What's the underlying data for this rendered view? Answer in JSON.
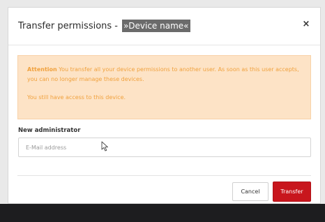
{
  "dialog": {
    "title_prefix": "Transfer permissions - ",
    "title_device": "»Device name«",
    "close_icon": "close-icon",
    "close_glyph": "×"
  },
  "alert": {
    "strong": "Attention",
    "text": " You transfer all your device permissions to another user. As soon as this user accepts, you can no longer manage these devices.",
    "note": "You still have access to this device.",
    "color": "#f0a13d",
    "background": "#fde3c6"
  },
  "form": {
    "label": "New administrator",
    "email_placeholder": "E-Mail address",
    "email_value": ""
  },
  "footer": {
    "cancel_label": "Cancel",
    "transfer_label": "Transfer",
    "transfer_color": "#c8161d"
  }
}
